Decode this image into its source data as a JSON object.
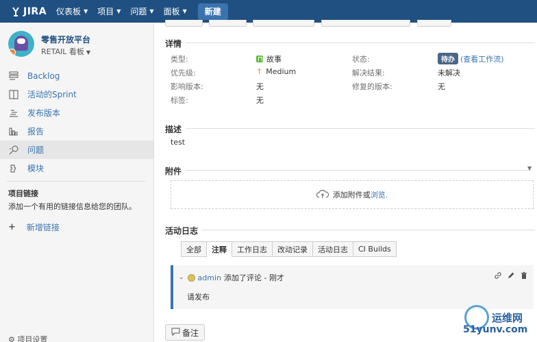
{
  "nav": {
    "logo": "JIRA",
    "items": [
      "仪表板",
      "项目",
      "问题",
      "面板"
    ],
    "create": "新建"
  },
  "sidebar": {
    "project_name": "零售开放平台",
    "project_sub": "RETAIL 看板",
    "items": [
      {
        "label": "Backlog",
        "icon": "backlog-icon"
      },
      {
        "label": "活动的Sprint",
        "icon": "sprint-icon"
      },
      {
        "label": "发布版本",
        "icon": "release-icon"
      },
      {
        "label": "报告",
        "icon": "report-icon"
      },
      {
        "label": "问题",
        "icon": "issues-icon"
      },
      {
        "label": "模块",
        "icon": "components-icon"
      }
    ],
    "active_index": 4,
    "links_title": "项目链接",
    "links_desc": "添加一个有用的链接信息给您的团队。",
    "add_link": "新增链接",
    "settings": "项目设置"
  },
  "details": {
    "title": "详情",
    "type_label": "类型:",
    "type_value": "故事",
    "priority_label": "优先级:",
    "priority_value": "Medium",
    "affects_label": "影响版本:",
    "affects_value": "无",
    "labels_label": "标签:",
    "labels_value": "无",
    "status_label": "状态:",
    "status_value": "待办",
    "status_link": "(查看工作流)",
    "resolution_label": "解决结果:",
    "resolution_value": "未解决",
    "fix_label": "修复的版本:",
    "fix_value": "无"
  },
  "description": {
    "title": "描述",
    "text": "test"
  },
  "attachments": {
    "title": "附件",
    "drop_text": "添加附件或",
    "browse": "浏览."
  },
  "activity": {
    "title": "活动日志",
    "tabs": [
      "全部",
      "注释",
      "工作日志",
      "改动记录",
      "活动日志",
      "CI Builds"
    ],
    "active_tab": 1,
    "comment": {
      "user": "admin",
      "action": "添加了评论 - 刚才",
      "body": "请发布"
    },
    "note_button": "备注"
  },
  "watermark": {
    "text": "运维网",
    "sub": "51yunv.com"
  }
}
